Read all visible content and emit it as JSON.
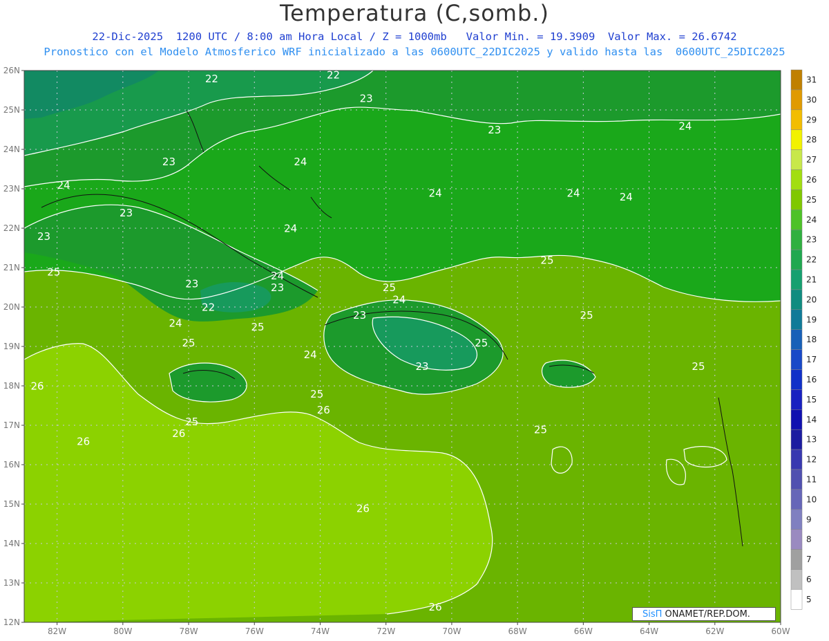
{
  "title": "Temperatura (C,somb.)",
  "subtitle_line1": "22-Dic-2025  1200 UTC / 8:00 am Hora Local / Z = 1000mb   Valor Min. = 19.3909  Valor Max. = 26.6742",
  "subtitle_line2": "Pronostico con el Modelo Atmosferico WRF inicializado a las 0600UTC_22DIC2025 y valido hasta las  0600UTC_25DIC2025",
  "credit": {
    "brand": "SisΠ",
    "text": " ONAMET/REP.DOM."
  },
  "map": {
    "lon_range": [
      -83,
      -60
    ],
    "lat_range": [
      12,
      26
    ],
    "lon_ticks": [
      "82W",
      "80W",
      "78W",
      "76W",
      "74W",
      "72W",
      "70W",
      "68W",
      "66W",
      "64W",
      "62W",
      "60W"
    ],
    "lat_ticks": [
      "12N",
      "13N",
      "14N",
      "15N",
      "16N",
      "17N",
      "18N",
      "19N",
      "20N",
      "21N",
      "22N",
      "23N",
      "24N",
      "25N",
      "26N"
    ],
    "contour_labels": [
      {
        "text": "22",
        "lon": -77.3,
        "lat": 25.7
      },
      {
        "text": "22",
        "lon": -73.6,
        "lat": 25.8
      },
      {
        "text": "23",
        "lon": -72.6,
        "lat": 25.2
      },
      {
        "text": "23",
        "lon": -78.6,
        "lat": 23.6
      },
      {
        "text": "24",
        "lon": -74.6,
        "lat": 23.6
      },
      {
        "text": "23",
        "lon": -68.7,
        "lat": 24.4
      },
      {
        "text": "24",
        "lon": -62.9,
        "lat": 24.5
      },
      {
        "text": "24",
        "lon": -81.8,
        "lat": 23.0
      },
      {
        "text": "24",
        "lon": -70.5,
        "lat": 22.8
      },
      {
        "text": "24",
        "lon": -66.3,
        "lat": 22.8
      },
      {
        "text": "24",
        "lon": -64.7,
        "lat": 22.7
      },
      {
        "text": "23",
        "lon": -79.9,
        "lat": 22.3
      },
      {
        "text": "23",
        "lon": -82.4,
        "lat": 21.7
      },
      {
        "text": "24",
        "lon": -74.9,
        "lat": 21.9
      },
      {
        "text": "25",
        "lon": -67.1,
        "lat": 21.1
      },
      {
        "text": "25",
        "lon": -82.1,
        "lat": 20.8
      },
      {
        "text": "24",
        "lon": -75.3,
        "lat": 20.7
      },
      {
        "text": "23",
        "lon": -75.3,
        "lat": 20.4
      },
      {
        "text": "23",
        "lon": -77.9,
        "lat": 20.5
      },
      {
        "text": "25",
        "lon": -71.9,
        "lat": 20.4
      },
      {
        "text": "24",
        "lon": -71.6,
        "lat": 20.1
      },
      {
        "text": "22",
        "lon": -77.4,
        "lat": 19.9
      },
      {
        "text": "23",
        "lon": -72.8,
        "lat": 19.7
      },
      {
        "text": "25",
        "lon": -65.9,
        "lat": 19.7
      },
      {
        "text": "24",
        "lon": -78.4,
        "lat": 19.5
      },
      {
        "text": "25",
        "lon": -75.9,
        "lat": 19.4
      },
      {
        "text": "25",
        "lon": -69.1,
        "lat": 19.0
      },
      {
        "text": "25",
        "lon": -78.0,
        "lat": 19.0
      },
      {
        "text": "24",
        "lon": -74.3,
        "lat": 18.7
      },
      {
        "text": "23",
        "lon": -70.9,
        "lat": 18.4
      },
      {
        "text": "25",
        "lon": -62.5,
        "lat": 18.4
      },
      {
        "text": "26",
        "lon": -82.6,
        "lat": 17.9
      },
      {
        "text": "25",
        "lon": -74.1,
        "lat": 17.7
      },
      {
        "text": "26",
        "lon": -73.9,
        "lat": 17.3
      },
      {
        "text": "25",
        "lon": -77.9,
        "lat": 17.0
      },
      {
        "text": "25",
        "lon": -67.3,
        "lat": 16.8
      },
      {
        "text": "26",
        "lon": -78.3,
        "lat": 16.7
      },
      {
        "text": "26",
        "lon": -81.2,
        "lat": 16.5
      },
      {
        "text": "26",
        "lon": -72.7,
        "lat": 14.8
      },
      {
        "text": "26",
        "lon": -70.5,
        "lat": 12.3
      }
    ]
  },
  "colorbar": {
    "labels": [
      "31",
      "30",
      "29",
      "28",
      "27",
      "26",
      "25",
      "24",
      "23",
      "22",
      "21",
      "20",
      "19",
      "18",
      "17",
      "16",
      "15",
      "14",
      "13",
      "12",
      "11",
      "10",
      "9",
      "8",
      "7",
      "6",
      "5"
    ],
    "colors": [
      "#c08000",
      "#e09a00",
      "#f2bd00",
      "#f2f200",
      "#c8e84a",
      "#a2de10",
      "#80c800",
      "#4ec228",
      "#30b040",
      "#20a850",
      "#16a070",
      "#108c80",
      "#107a98",
      "#1860b8",
      "#1848c8",
      "#1030c8",
      "#1820c0",
      "#1010b0",
      "#1c1ca0",
      "#3838b0",
      "#5050b0",
      "#6666b8",
      "#8080c0",
      "#9a8ac0",
      "#a0a0a0",
      "#c0c0c0",
      "#ffffff"
    ]
  }
}
